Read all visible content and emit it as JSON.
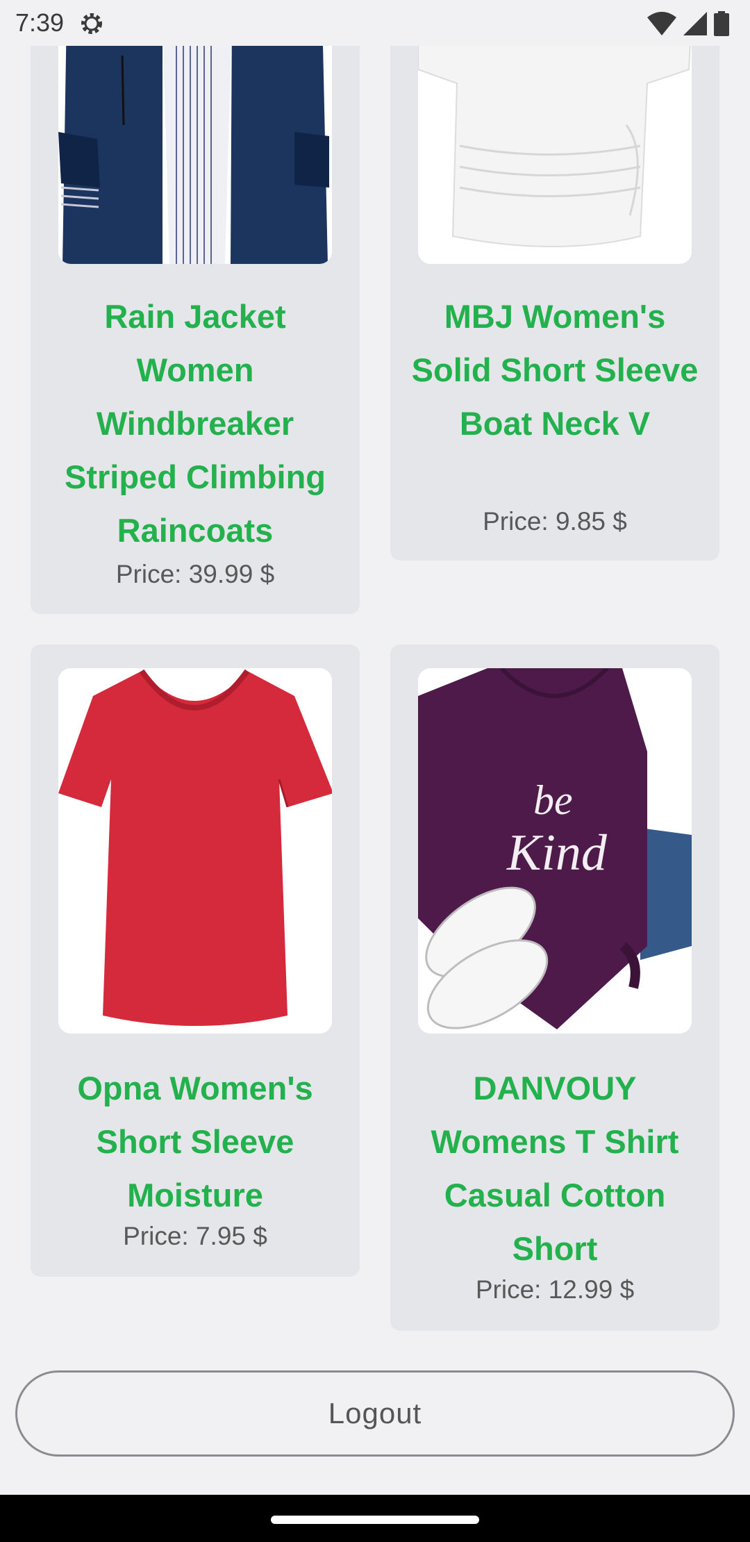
{
  "status": {
    "time": "7:39"
  },
  "products": [
    {
      "title": "Rain Jacket Women Windbreaker Striped Climbing Raincoats",
      "price": "Price: 39.99 $"
    },
    {
      "title": "MBJ Women's Solid Short Sleeve Boat Neck V",
      "price": "Price: 9.85 $"
    },
    {
      "title": "Opna Women's Short Sleeve Moisture",
      "price": "Price: 7.95 $"
    },
    {
      "title": "DANVOUY Womens T Shirt Casual Cotton Short",
      "price": "Price: 12.99 $"
    }
  ],
  "shirt_print": {
    "line1": "be",
    "line2": "Kind"
  },
  "colors": {
    "title_green": "#22b14c",
    "card_bg": "#e5e6ea",
    "jacket_navy": "#1c355e",
    "red_shirt": "#d42a3c",
    "purple_shirt": "#4e1a4a"
  },
  "logout_label": "Logout"
}
